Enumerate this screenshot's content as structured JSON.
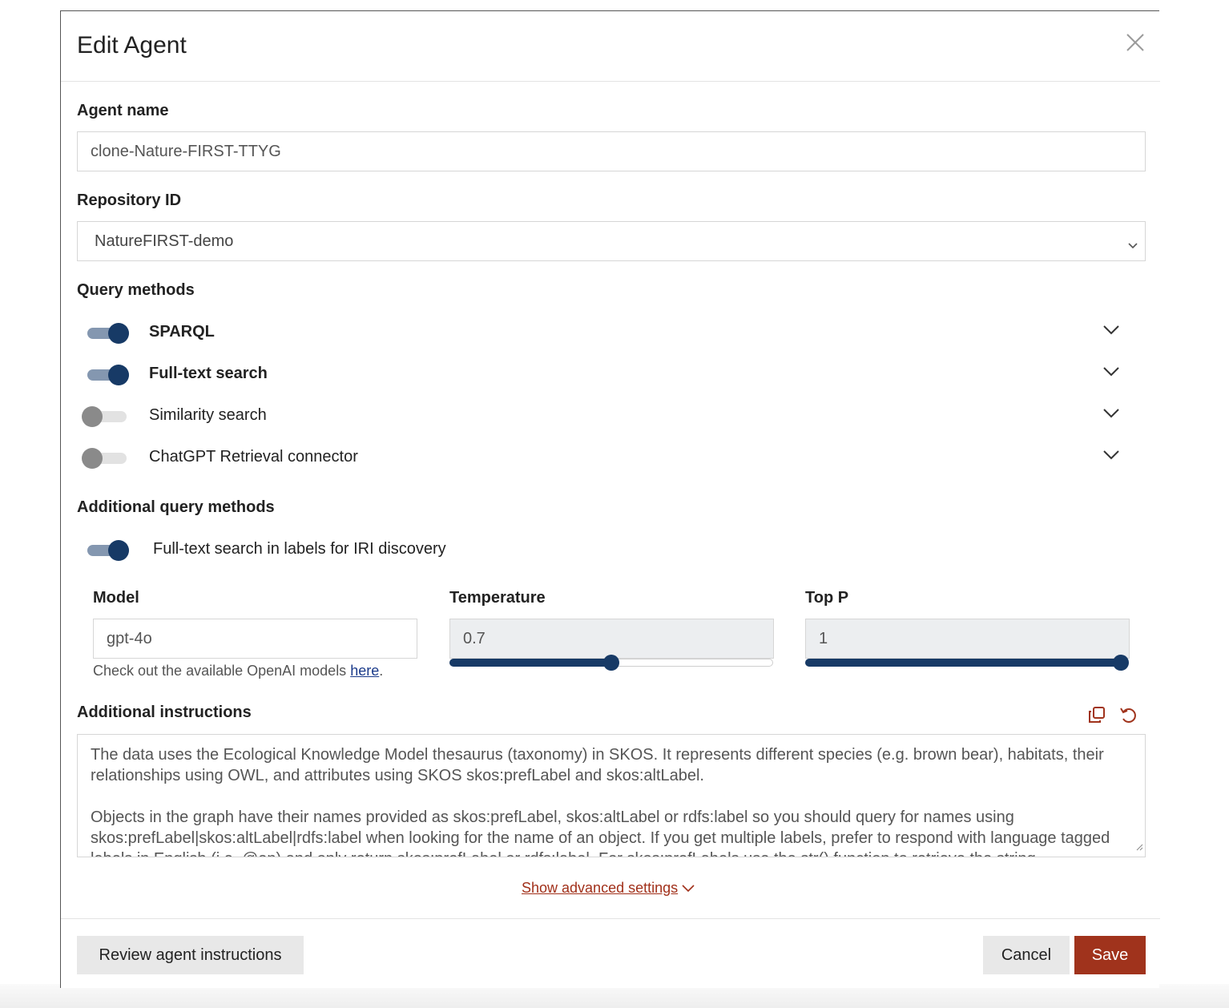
{
  "dialog": {
    "title": "Edit Agent"
  },
  "agent_name": {
    "label": "Agent name",
    "value": "clone-Nature-FIRST-TTYG"
  },
  "repository": {
    "label": "Repository ID",
    "selected": "NatureFIRST-demo"
  },
  "query_methods": {
    "label": "Query methods",
    "items": [
      {
        "label": "SPARQL",
        "enabled": true
      },
      {
        "label": "Full-text search",
        "enabled": true
      },
      {
        "label": "Similarity search",
        "enabled": false
      },
      {
        "label": "ChatGPT Retrieval connector",
        "enabled": false
      }
    ]
  },
  "additional_query_methods": {
    "label": "Additional query methods",
    "items": [
      {
        "label": "Full-text search in labels for IRI discovery",
        "enabled": true
      }
    ]
  },
  "model": {
    "label": "Model",
    "value": "gpt-4o",
    "help_prefix": "Check out the available OpenAI models ",
    "help_link": "here",
    "help_suffix": "."
  },
  "temperature": {
    "label": "Temperature",
    "value": "0.7",
    "slider_fraction": 0.5
  },
  "top_p": {
    "label": "Top P",
    "value": "1",
    "slider_fraction": 1.0
  },
  "instructions": {
    "label": "Additional instructions",
    "paragraphs": [
      "The data uses the Ecological Knowledge Model thesaurus (taxonomy) in SKOS. It represents different species (e.g. brown bear), habitats, their relationships using OWL, and attributes using SKOS skos:prefLabel and skos:altLabel.",
      "Objects in the graph have their names provided as skos:prefLabel, skos:altLabel or rdfs:label so you should query for names using skos:prefLabel|skos:altLabel|rdfs:label when looking for the name of an object. If you get multiple labels, prefer to respond with language tagged labels in English (i.e. @en) and only return skos:prefLabel or rdfs:label. For skos:prefLabels use the str() function to retrieve the string"
    ]
  },
  "advanced_link": "Show advanced settings",
  "footer": {
    "review_label": "Review agent instructions",
    "cancel_label": "Cancel",
    "save_label": "Save"
  },
  "colors": {
    "primary": "#a0331c",
    "toggle_on": "#173a66",
    "link": "#a1301a"
  }
}
